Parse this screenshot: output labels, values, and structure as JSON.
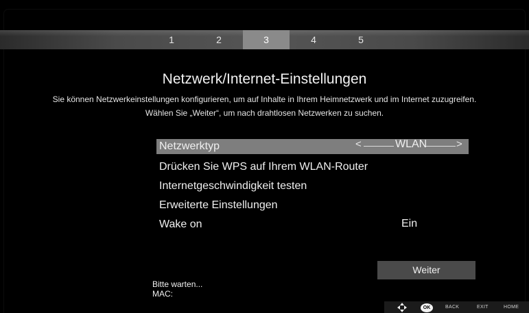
{
  "steps": {
    "items": [
      "1",
      "2",
      "3",
      "4",
      "5"
    ],
    "active_index": 3
  },
  "page": {
    "title": "Netzwerk/Internet-Einstellungen",
    "description_line1": "Sie können Netzwerkeinstellungen konfigurieren, um auf Inhalte in Ihrem Heimnetzwerk und im Internet zuzugreifen.",
    "description_line2": "Wählen Sie „Weiter“, um nach drahtlosen Netzwerken zu suchen."
  },
  "menu": {
    "items": [
      {
        "label": "Netzwerktyp",
        "value": "WLAN"
      },
      {
        "label": "Drücken Sie WPS auf Ihrem WLAN-Router"
      },
      {
        "label": "Internetgeschwindigkeit testen"
      },
      {
        "label": "Erweiterte Einstellungen"
      },
      {
        "label": "Wake on",
        "value": "Ein"
      }
    ],
    "arrow_left": "<",
    "arrow_right": ">"
  },
  "actions": {
    "next_label": "Weiter"
  },
  "status": {
    "wait_text": "Bitte warten...",
    "mac_label": "MAC:"
  },
  "footer": {
    "ok_label": "OK",
    "back_label": "BACK",
    "exit_label": "EXIT",
    "home_label": "HOME",
    "icons": [
      "navigation-arrows-icon",
      "ok-button-icon"
    ]
  },
  "colors": {
    "background": "#000000",
    "step_active": "#8a8a8a",
    "row_selected": "#7e7e7e",
    "button_bg": "#4a4a4a"
  }
}
